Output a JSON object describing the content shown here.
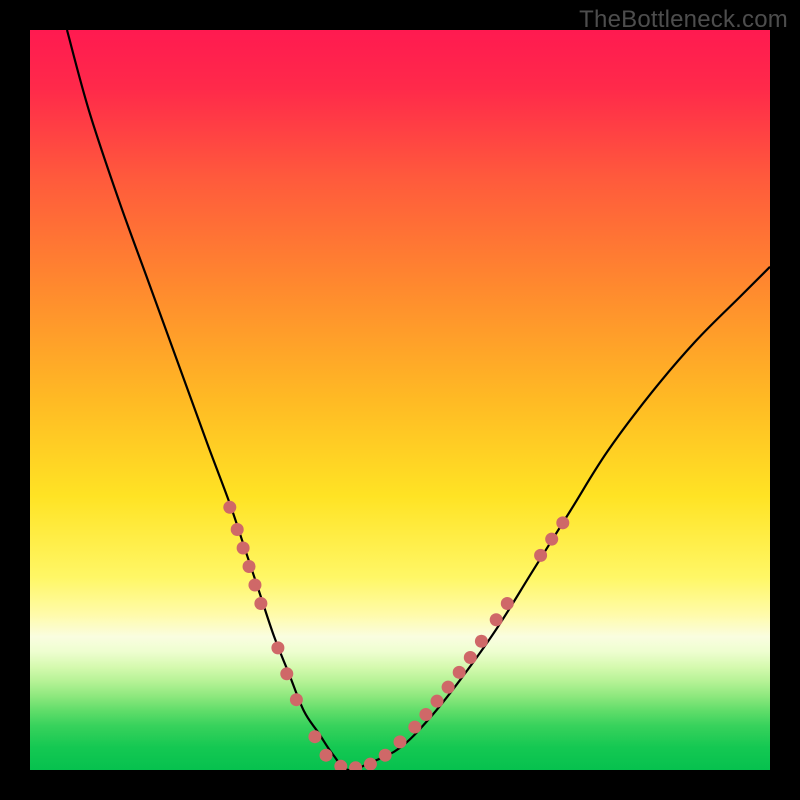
{
  "watermark": "TheBottleneck.com",
  "colors": {
    "page_bg": "#000000",
    "curve_stroke": "#000000",
    "dot_fill": "#cf6868"
  },
  "chart_data": {
    "type": "line",
    "title": "",
    "xlabel": "",
    "ylabel": "",
    "xlim": [
      0,
      100
    ],
    "ylim": [
      0,
      100
    ],
    "gradient_stops": [
      {
        "offset": 0,
        "color": "#ff1a50"
      },
      {
        "offset": 8,
        "color": "#ff2a4a"
      },
      {
        "offset": 20,
        "color": "#ff5a3c"
      },
      {
        "offset": 35,
        "color": "#ff8a2e"
      },
      {
        "offset": 50,
        "color": "#ffba24"
      },
      {
        "offset": 63,
        "color": "#ffe324"
      },
      {
        "offset": 74,
        "color": "#fff766"
      },
      {
        "offset": 79,
        "color": "#fffbaa"
      },
      {
        "offset": 82,
        "color": "#fafde0"
      },
      {
        "offset": 84,
        "color": "#eefed0"
      },
      {
        "offset": 86,
        "color": "#d6fab0"
      },
      {
        "offset": 88,
        "color": "#b6f296"
      },
      {
        "offset": 90,
        "color": "#8ee87e"
      },
      {
        "offset": 92,
        "color": "#60dd6a"
      },
      {
        "offset": 94,
        "color": "#38d25c"
      },
      {
        "offset": 97,
        "color": "#14c852"
      },
      {
        "offset": 100,
        "color": "#06c14e"
      }
    ],
    "curve": {
      "x": [
        5,
        8,
        12,
        16,
        20,
        24,
        27,
        29,
        31,
        33,
        35,
        37,
        39,
        41,
        43,
        46,
        50,
        54,
        58,
        63,
        68,
        73,
        78,
        84,
        90,
        96,
        100
      ],
      "y": [
        100,
        89,
        77,
        66,
        55,
        44,
        36,
        30,
        24,
        18,
        13,
        8,
        5,
        2,
        0,
        1,
        3,
        7,
        12,
        19,
        27,
        35,
        43,
        51,
        58,
        64,
        68
      ]
    },
    "dots": {
      "radius": 6.5,
      "points": [
        {
          "x": 27.0,
          "y": 35.5
        },
        {
          "x": 28.0,
          "y": 32.5
        },
        {
          "x": 28.8,
          "y": 30.0
        },
        {
          "x": 29.6,
          "y": 27.5
        },
        {
          "x": 30.4,
          "y": 25.0
        },
        {
          "x": 31.2,
          "y": 22.5
        },
        {
          "x": 33.5,
          "y": 16.5
        },
        {
          "x": 34.7,
          "y": 13.0
        },
        {
          "x": 36.0,
          "y": 9.5
        },
        {
          "x": 38.5,
          "y": 4.5
        },
        {
          "x": 40.0,
          "y": 2.0
        },
        {
          "x": 42.0,
          "y": 0.5
        },
        {
          "x": 44.0,
          "y": 0.3
        },
        {
          "x": 46.0,
          "y": 0.8
        },
        {
          "x": 48.0,
          "y": 2.0
        },
        {
          "x": 50.0,
          "y": 3.8
        },
        {
          "x": 52.0,
          "y": 5.8
        },
        {
          "x": 53.5,
          "y": 7.5
        },
        {
          "x": 55.0,
          "y": 9.3
        },
        {
          "x": 56.5,
          "y": 11.2
        },
        {
          "x": 58.0,
          "y": 13.2
        },
        {
          "x": 59.5,
          "y": 15.2
        },
        {
          "x": 61.0,
          "y": 17.4
        },
        {
          "x": 63.0,
          "y": 20.3
        },
        {
          "x": 64.5,
          "y": 22.5
        },
        {
          "x": 69.0,
          "y": 29.0
        },
        {
          "x": 70.5,
          "y": 31.2
        },
        {
          "x": 72.0,
          "y": 33.4
        }
      ]
    }
  }
}
